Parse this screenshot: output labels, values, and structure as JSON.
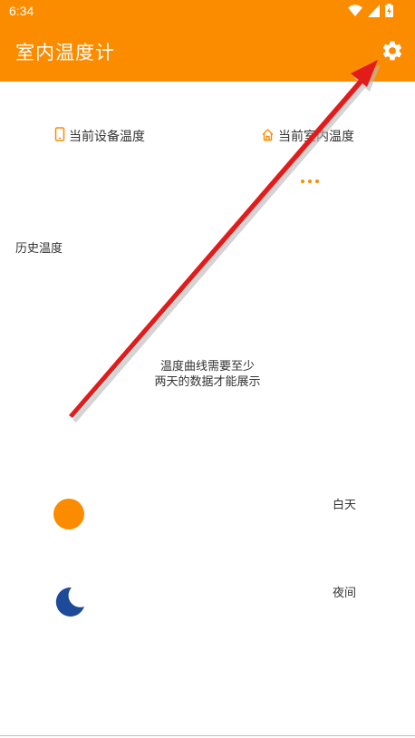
{
  "status_bar": {
    "time": "6:34",
    "icons": [
      "wifi-icon",
      "cellular-icon",
      "battery-charging-icon"
    ]
  },
  "app_bar": {
    "title": "室内温度计",
    "settings_icon": "gear-icon"
  },
  "tabs": [
    {
      "label": "当前设备温度",
      "icon": "phone-icon"
    },
    {
      "label": "当前室内温度",
      "icon": "home-icon"
    }
  ],
  "history": {
    "label": "历史温度",
    "empty_message_line1": "温度曲线需要至少",
    "empty_message_line2": "两天的数据才能展示"
  },
  "legend": {
    "day_label": "白天",
    "day_icon": "sun-circle-icon",
    "night_label": "夜间",
    "night_icon": "moon-icon"
  },
  "colors": {
    "accent": "#fb8c00",
    "night": "#1e4a9a",
    "annotation_arrow": "#e31b1b"
  }
}
